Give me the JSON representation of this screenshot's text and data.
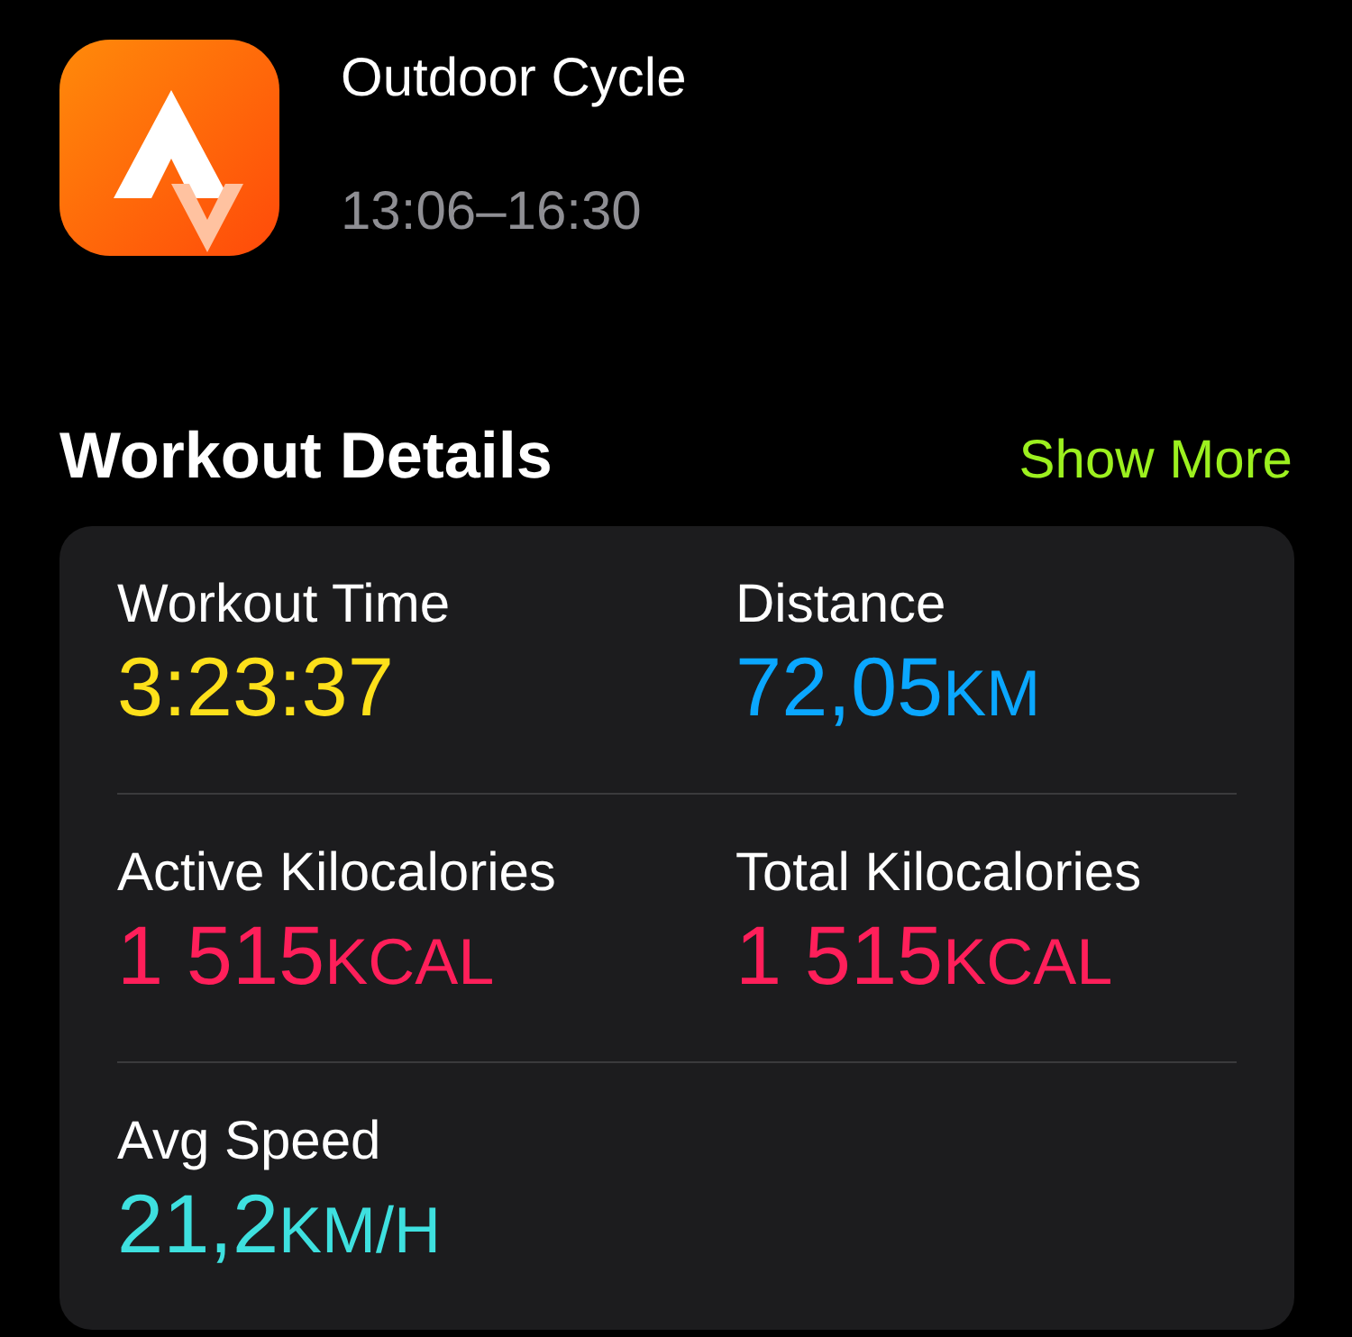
{
  "workout": {
    "title": "Outdoor Cycle",
    "time": "13:06–16:30"
  },
  "section": {
    "title": "Workout Details",
    "action": "Show More"
  },
  "metrics": [
    {
      "label": "Workout Time",
      "value": "3:23:37",
      "color": "#fde01a"
    },
    {
      "label": "Distance",
      "value": "72,05",
      "unit": "KM",
      "color": "#0aa7ff"
    },
    {
      "label": "Active Kilocalories",
      "value": "1 515",
      "unit": "KCAL",
      "color": "#ff1f5a"
    },
    {
      "label": "Total Kilocalories",
      "value": "1 515",
      "unit": "KCAL",
      "color": "#ff1f5a"
    },
    {
      "label": "Avg Speed",
      "value": "21,2",
      "unit": "KM/H",
      "color": "#3ee0df"
    }
  ]
}
